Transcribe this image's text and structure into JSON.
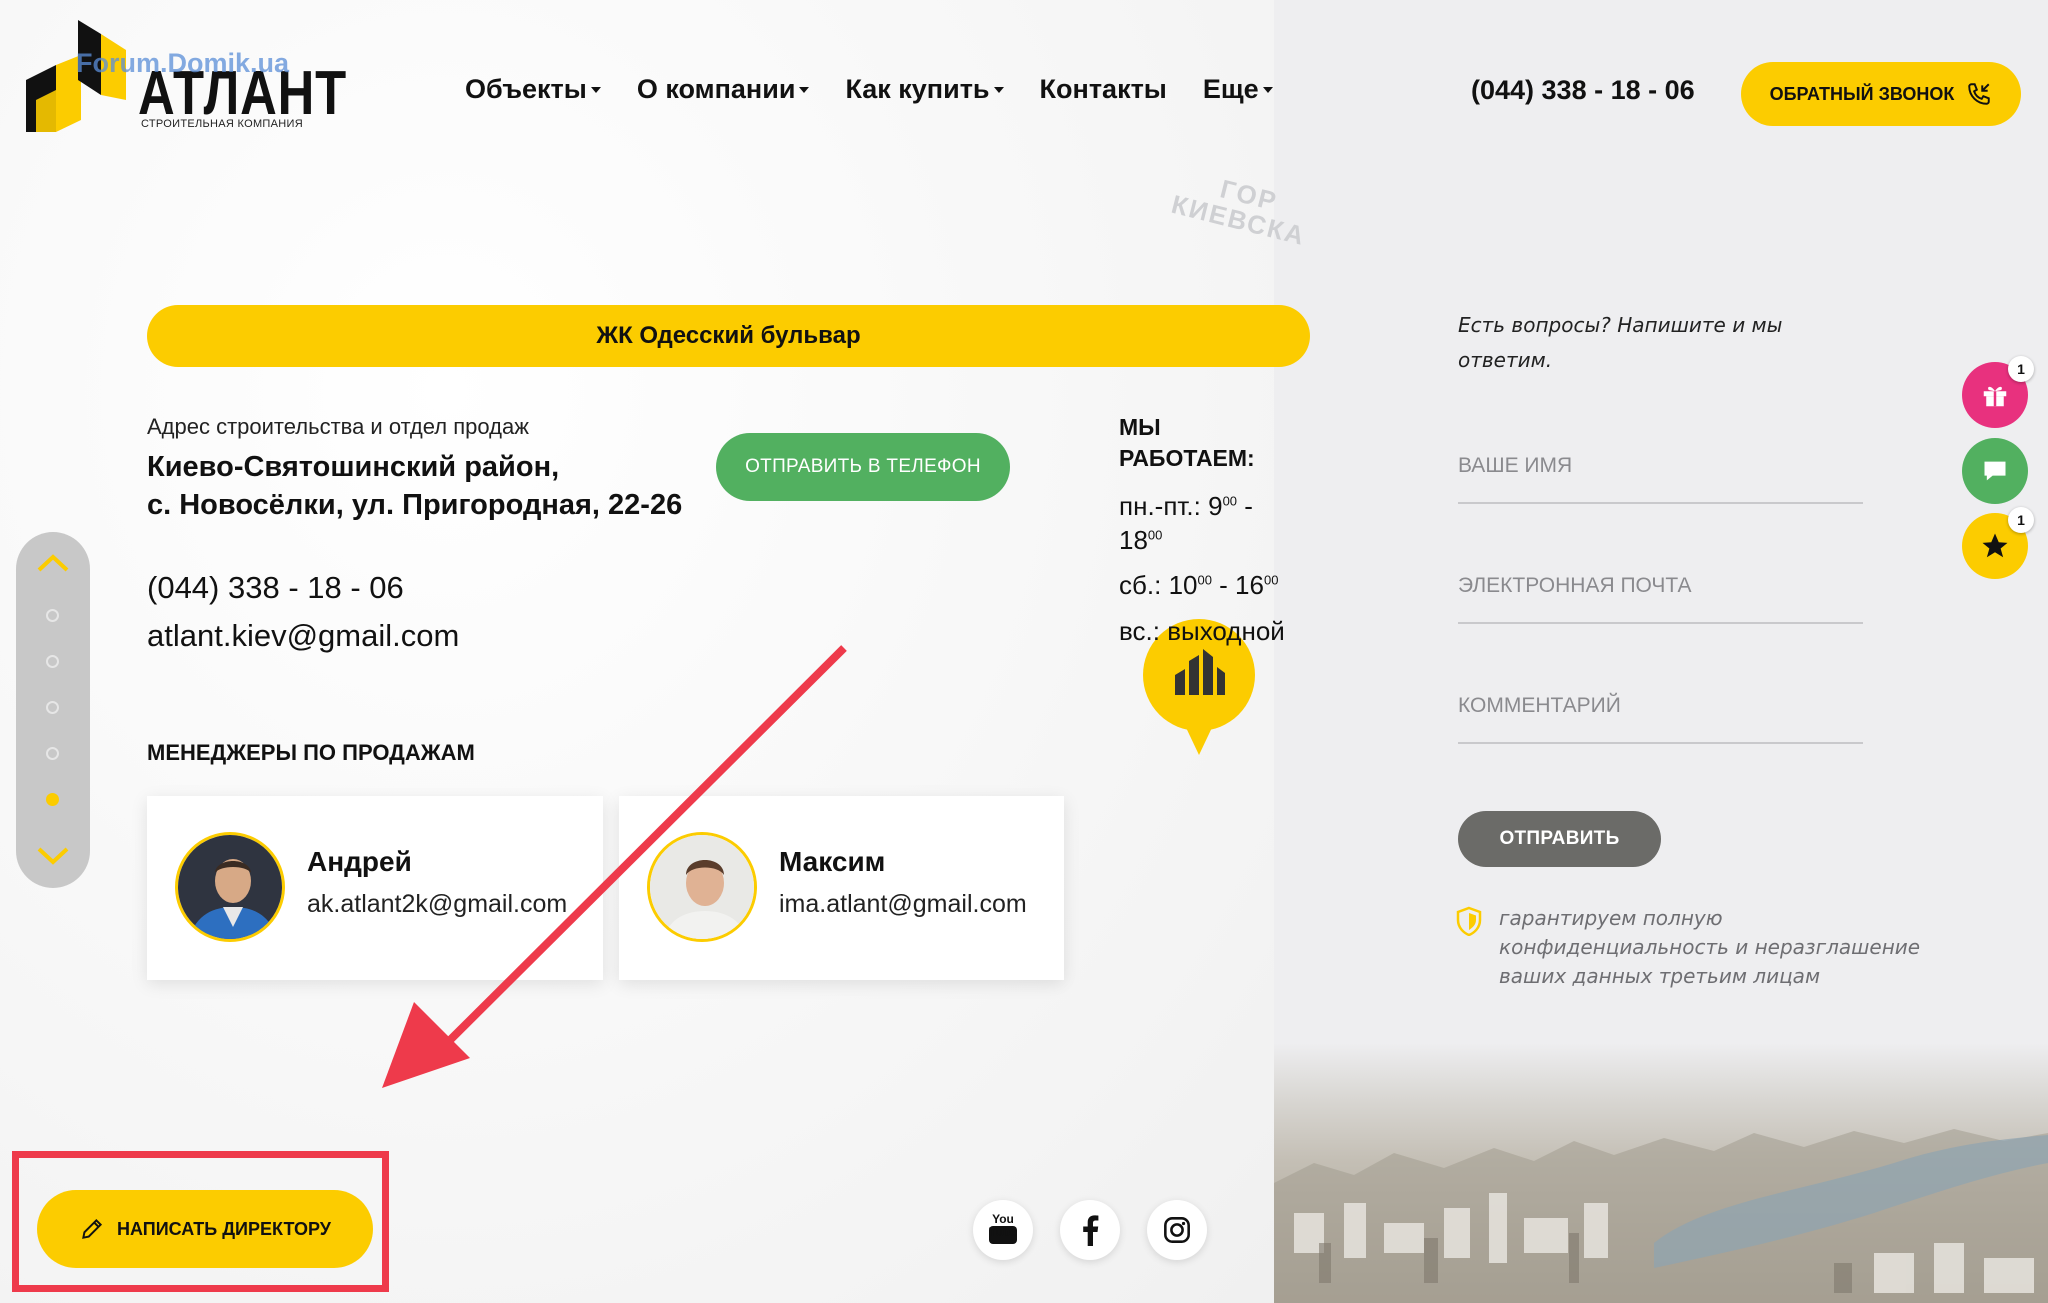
{
  "header": {
    "logo": {
      "watermark_text": "Forum.Domik.ua",
      "brand_name": "АТЛАНТ",
      "brand_subtitle": "СТРОИТЕЛЬНАЯ КОМПАНИЯ"
    },
    "nav": [
      {
        "label": "Объекты",
        "has_dropdown": true
      },
      {
        "label": "О компании",
        "has_dropdown": true
      },
      {
        "label": "Как купить",
        "has_dropdown": true
      },
      {
        "label": "Контакты",
        "has_dropdown": false
      },
      {
        "label": "Еще",
        "has_dropdown": true
      }
    ],
    "phone": "(044) 338 - 18 - 06",
    "callback_button": "ОБРАТНЫЙ ЗВОНОК"
  },
  "background_text": {
    "line1": "ГОР",
    "line2": "КИЕВСКА"
  },
  "main": {
    "project_title": "ЖК Одесский бульвар",
    "address_label": "Адрес строительства и отдел продаж",
    "address_line1": "Киево-Святошинский район,",
    "address_line2": "с. Новосёлки, ул. Пригородная, 22-26",
    "send_to_phone_button": "ОТПРАВИТЬ В ТЕЛЕФОН",
    "phone": "(044) 338 - 18 - 06",
    "email": "atlant.kiev@gmail.com",
    "hours": {
      "title_line1": "МЫ",
      "title_line2": "РАБОТАЕМ:",
      "weekdays_prefix": "пн.-пт.: 9",
      "weekdays_sup1": "00",
      "weekdays_mid": " -",
      "weekdays_end": "18",
      "weekdays_sup2": "00",
      "saturday_prefix": "сб.: 10",
      "saturday_sup1": "00",
      "saturday_mid": " - 16",
      "saturday_sup2": "00",
      "sunday": "вс.: выходной"
    },
    "managers_title": "МЕНЕДЖЕРЫ ПО ПРОДАЖАМ",
    "managers": [
      {
        "name": "Андрей",
        "email": "ak.atlant2k@gmail.com"
      },
      {
        "name": "Максим",
        "email": "ima.atlant@gmail.com"
      }
    ]
  },
  "slider": {
    "dots": 5,
    "active_index": 4
  },
  "form": {
    "intro": "Есть вопросы? Напишите и мы ответим.",
    "name_placeholder": "ВАШЕ ИМЯ",
    "email_placeholder": "ЭЛЕКТРОННАЯ ПОЧТА",
    "comment_placeholder": "КОММЕНТАРИЙ",
    "submit": "ОТПРАВИТЬ",
    "privacy_note": "гарантируем полную конфиденциальность и неразглашение ваших данных третьим лицам"
  },
  "floating": {
    "gift_badge": "1",
    "favorites_badge": "1",
    "gift_icon": "gift-icon",
    "chat_icon": "chat-icon",
    "star_icon": "star-icon"
  },
  "footer": {
    "write_director_button": "НАПИСАТЬ ДИРЕКТОРУ",
    "youtube_label": "You Tube",
    "social_icons": [
      "youtube-icon",
      "facebook-icon",
      "instagram-icon"
    ]
  },
  "colors": {
    "accent_yellow": "#fccc00",
    "send_green": "#52b060",
    "gift_pink": "#e8317e",
    "chat_green": "#52b060",
    "annotation_red": "#ee3a4b",
    "submit_gray": "#6b6b68"
  }
}
